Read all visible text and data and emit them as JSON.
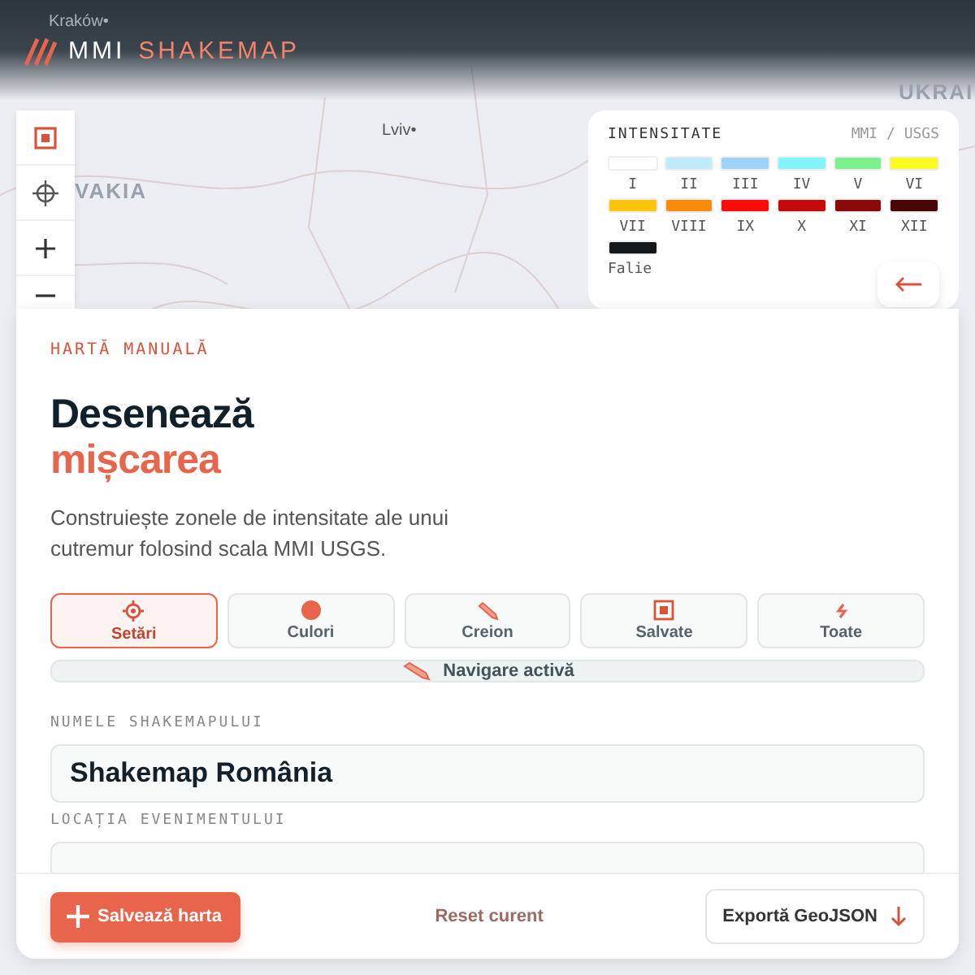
{
  "map": {
    "labels": [
      "Lviv•",
      "UKRAI",
      "VAKIA",
      "Kraków•"
    ]
  },
  "header": {
    "logo_word_1": "MMI",
    "logo_word_2": "SHAKEMAP"
  },
  "legend": {
    "title": "INTENSITATE",
    "scale": "MMI / USGS",
    "items": [
      {
        "label": "I",
        "color": "#ffffff"
      },
      {
        "label": "II",
        "color": "#bfeafb"
      },
      {
        "label": "III",
        "color": "#9ed3f7"
      },
      {
        "label": "IV",
        "color": "#84f4fb"
      },
      {
        "label": "V",
        "color": "#7cf08a"
      },
      {
        "label": "VI",
        "color": "#fcfc22"
      },
      {
        "label": "VII",
        "color": "#fcc40a"
      },
      {
        "label": "VIII",
        "color": "#fc8a0a"
      },
      {
        "label": "IX",
        "color": "#fb0a0a"
      },
      {
        "label": "X",
        "color": "#c40a0a"
      },
      {
        "label": "XI",
        "color": "#8a0a0a"
      },
      {
        "label": "XII",
        "color": "#4a0606"
      },
      {
        "label": "Falie",
        "color": "#12181c"
      }
    ]
  },
  "panel": {
    "eyebrow": "HARTĂ MANUALĂ",
    "title_line_1": "Desenează",
    "title_line_2": "mișcarea",
    "description": "Construiește zonele de intensitate ale unui cutremur folosind scala MMI USGS.",
    "tabs": [
      {
        "label": "Setări",
        "selected": true
      },
      {
        "label": "Culori",
        "selected": false
      },
      {
        "label": "Creion",
        "selected": false
      },
      {
        "label": "Salvate",
        "selected": false
      },
      {
        "label": "Toate",
        "selected": false
      }
    ],
    "mode_bar": "Navigare activă",
    "fields": [
      {
        "label": "NUMELE SHAKEMAPULUI",
        "value": "Shakemap România"
      },
      {
        "label": "LOCAȚIA EVENIMENTULUI"
      }
    ],
    "footer": {
      "save": "Salvează harta",
      "reset": "Reset curent",
      "export": "Exportă GeoJSON"
    }
  }
}
